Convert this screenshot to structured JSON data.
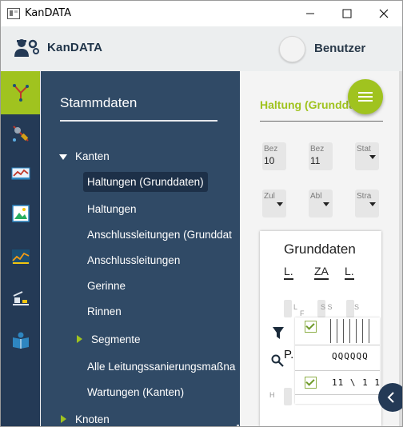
{
  "window": {
    "title": "KanDATA",
    "controls": {
      "minimize": "—",
      "maximize": "☐",
      "close": "✕"
    }
  },
  "header": {
    "app_name": "KanDATA",
    "user_label": "Benutzer"
  },
  "rail": {
    "items": [
      {
        "icon": "network-icon",
        "active": true
      },
      {
        "icon": "tools-icon",
        "active": false
      },
      {
        "icon": "chart-icon",
        "active": false
      },
      {
        "icon": "image-icon",
        "active": false
      },
      {
        "icon": "profile-chart-icon",
        "active": false
      },
      {
        "icon": "level-icon",
        "active": false
      },
      {
        "icon": "book-user-icon",
        "active": false
      }
    ]
  },
  "nav": {
    "title": "Stammdaten",
    "groups": {
      "kanten": "Kanten",
      "items": [
        "Haltungen (Grunddaten)",
        "Haltungen",
        "Anschlussleitungen (Grunddat",
        "Anschlussleitungen",
        "Gerinne",
        "Rinnen"
      ],
      "segmente": "Segmente",
      "more_items": [
        "Alle Leitungssanierungsmaßna",
        "Wartungen (Kanten)"
      ],
      "knoten": "Knoten"
    }
  },
  "main": {
    "heading": "Haltung (Grunddaten)",
    "fields_row1": [
      {
        "label": "Bez",
        "value": "10"
      },
      {
        "label": "Bez",
        "value": "11"
      },
      {
        "label": "Stat",
        "value": ""
      }
    ],
    "fields_row2": [
      {
        "label": "Zul",
        "value": ""
      },
      {
        "label": "Abl",
        "value": ""
      },
      {
        "label": "Stra",
        "value": ""
      }
    ],
    "card": {
      "title": "Grunddaten",
      "tabs": [
        "L.",
        "ZA",
        "L."
      ],
      "col_labels": [
        "L",
        "S S",
        "S"
      ],
      "side_label_f": "F",
      "side_label_h": "H",
      "search_text": "P.",
      "row1_text": "QQQQQQ",
      "row2_text": "11 \\ 1 1"
    }
  },
  "colors": {
    "accent": "#a0c31f",
    "rail": "#243a56",
    "nav": "#304a66"
  }
}
